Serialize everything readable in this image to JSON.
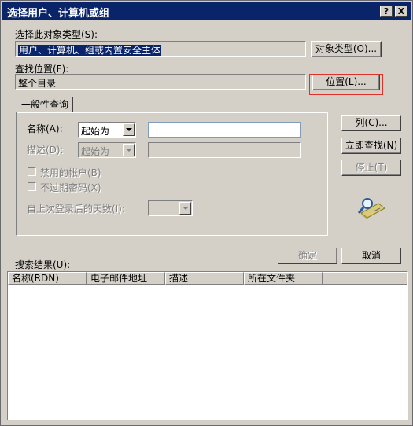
{
  "window": {
    "title": "选择用户、计算机或组",
    "help_button": "?",
    "close_button": "X"
  },
  "object_type": {
    "label": "选择此对象类型(S):",
    "value": "用户、计算机、组或内置安全主体",
    "button": "对象类型(O)..."
  },
  "location": {
    "label": "查找位置(F):",
    "value": "整个目录",
    "button": "位置(L)..."
  },
  "query_tab": {
    "label": "一般性查询"
  },
  "query": {
    "name_label": "名称(A):",
    "name_mode": "起始为",
    "name_value": "",
    "desc_label": "描述(D):",
    "desc_mode": "起始为",
    "desc_value": "",
    "disabled_accounts": "禁用的帐户(B)",
    "non_expiring_pw": "不过期密码(X)",
    "days_label": "自上次登录后的天数(I):",
    "days_value": ""
  },
  "side_buttons": {
    "columns": "列(C)...",
    "find_now": "立即查找(N)",
    "stop": "停止(T)"
  },
  "actions": {
    "ok": "确定",
    "cancel": "取消"
  },
  "results": {
    "label": "搜索结果(U):",
    "columns": [
      "名称(RDN)",
      "电子邮件地址",
      "描述",
      "所在文件夹"
    ]
  }
}
